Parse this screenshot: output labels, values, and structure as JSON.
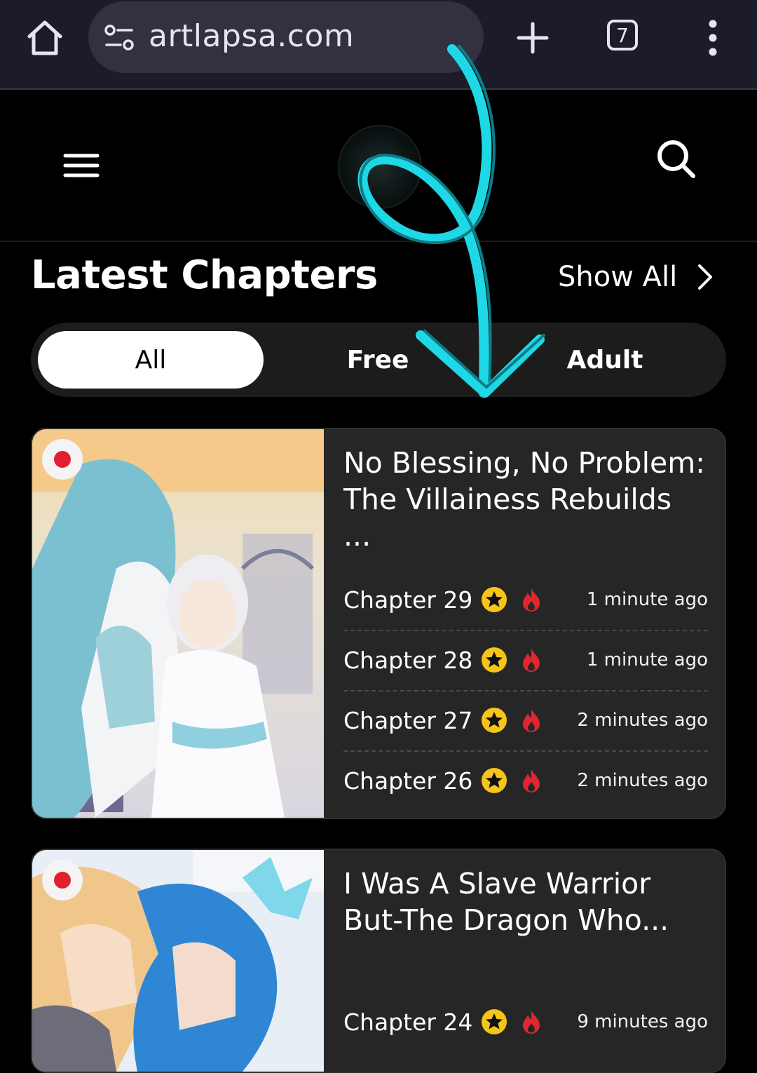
{
  "browser": {
    "url": "artlapsa.com",
    "tab_count": "7"
  },
  "section": {
    "title": "Latest Chapters",
    "show_all": "Show All"
  },
  "filters": [
    {
      "label": "All",
      "active": true
    },
    {
      "label": "Free",
      "active": false
    },
    {
      "label": "Adult",
      "active": false
    }
  ],
  "cards": [
    {
      "title": "No Blessing, No Problem: The Villainess Rebuilds ...",
      "chapters": [
        {
          "label": "Chapter 29",
          "time": "1 minute ago"
        },
        {
          "label": "Chapter 28",
          "time": "1 minute ago"
        },
        {
          "label": "Chapter 27",
          "time": "2 minutes ago"
        },
        {
          "label": "Chapter 26",
          "time": "2 minutes ago"
        }
      ]
    },
    {
      "title": "I Was A Slave Warrior But-The Dragon Who...",
      "chapters": [
        {
          "label": "Chapter 24",
          "time": "9 minutes ago"
        }
      ]
    }
  ],
  "colors": {
    "accent_cyan": "#1fd8e6",
    "hot_red": "#e21f2f",
    "star_yellow": "#f5c518"
  }
}
